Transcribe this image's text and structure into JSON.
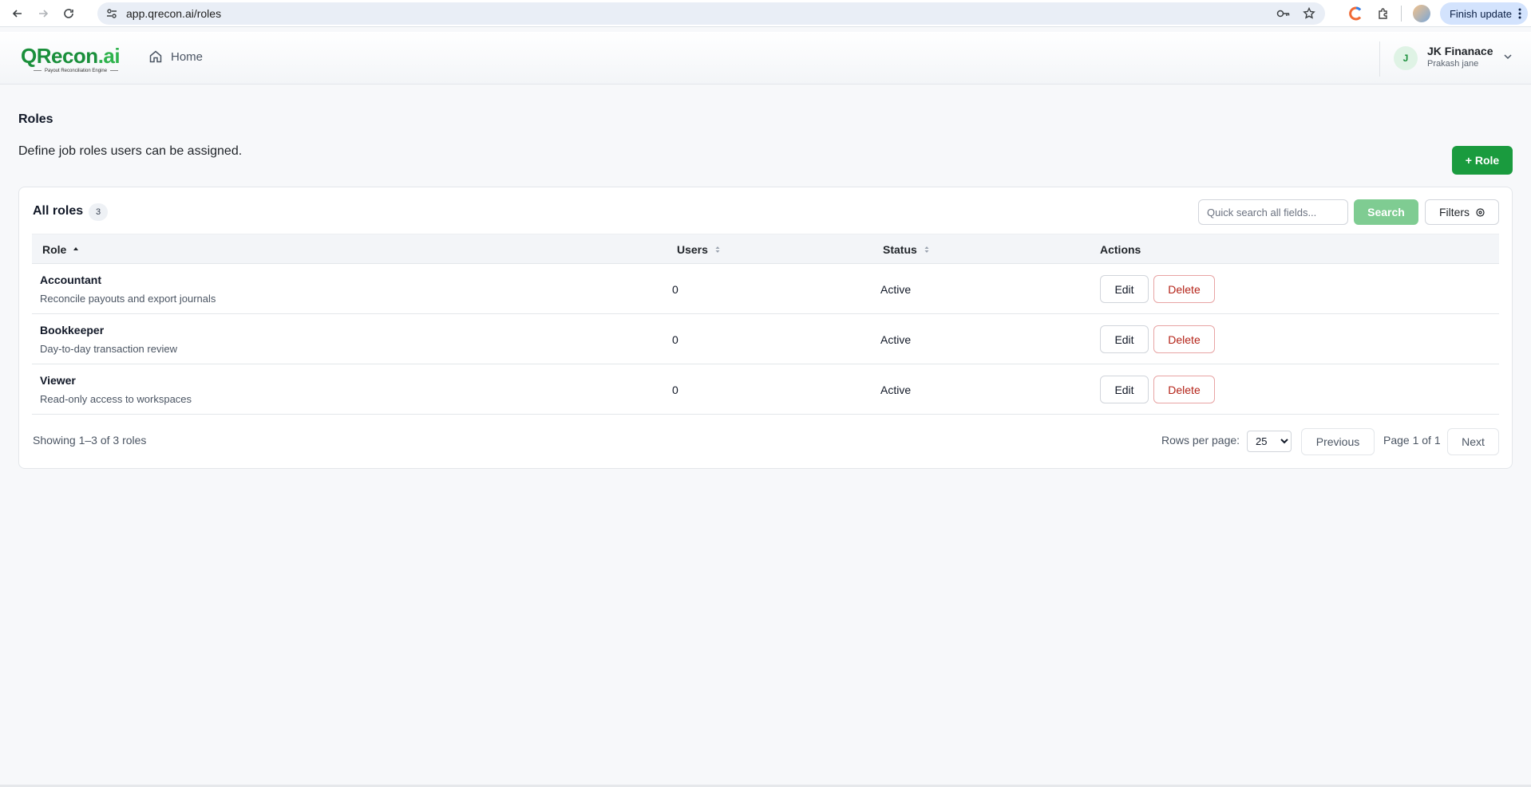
{
  "browser": {
    "url": "app.qrecon.ai/roles",
    "update_label": "Finish update"
  },
  "header": {
    "logo_word": "QRecon",
    "logo_suffix": ".ai",
    "logo_tagline": "Payout Reconciliation Engine",
    "home_label": "Home",
    "user_initial": "J",
    "user_org": "JK Finanace",
    "user_name": "Prakash jane"
  },
  "page": {
    "title": "Roles",
    "description": "Define job roles users can be assigned.",
    "add_button": "+ Role"
  },
  "card": {
    "title": "All roles",
    "count": "3",
    "search_placeholder": "Quick search all fields...",
    "search_button": "Search",
    "filters_button": "Filters"
  },
  "table": {
    "columns": [
      "Role",
      "Users",
      "Status",
      "Actions"
    ],
    "rows": [
      {
        "name": "Accountant",
        "description": "Reconcile payouts and export journals",
        "users": "0",
        "status": "Active",
        "edit": "Edit",
        "delete": "Delete"
      },
      {
        "name": "Bookkeeper",
        "description": "Day-to-day transaction review",
        "users": "0",
        "status": "Active",
        "edit": "Edit",
        "delete": "Delete"
      },
      {
        "name": "Viewer",
        "description": "Read-only access to workspaces",
        "users": "0",
        "status": "Active",
        "edit": "Edit",
        "delete": "Delete"
      }
    ]
  },
  "pagination": {
    "showing": "Showing 1–3 of 3 roles",
    "rows_per_page_label": "Rows per page:",
    "rows_per_page_value": "25",
    "previous": "Previous",
    "page_info": "Page 1 of 1",
    "next": "Next"
  },
  "colors": {
    "brand_green": "#1a9b3e",
    "search_green": "#7fcc92",
    "delete_red": "#b42318"
  }
}
